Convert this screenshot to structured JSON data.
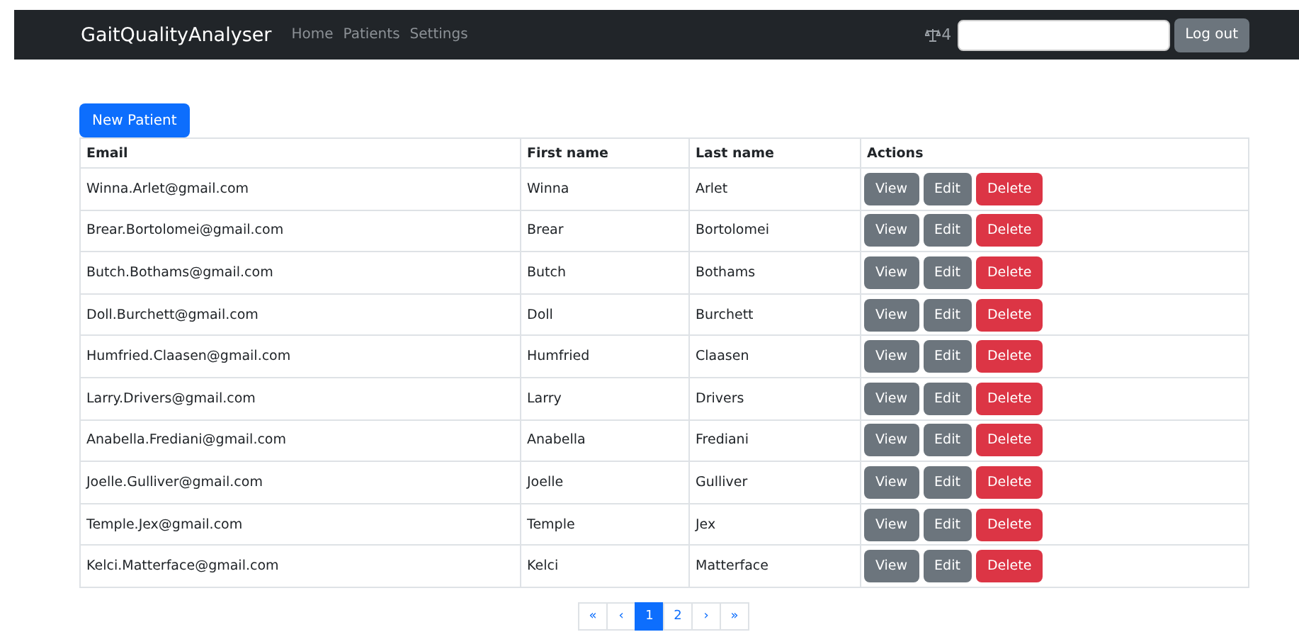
{
  "navbar": {
    "brand": "GaitQualityAnalyser",
    "links": [
      "Home",
      "Patients",
      "Settings"
    ],
    "badge_count": "4",
    "logout": "Log out"
  },
  "new_button": "New Patient",
  "table": {
    "columns": [
      "Email",
      "First name",
      "Last name",
      "Actions"
    ],
    "rows": [
      {
        "email": "Winna.Arlet@gmail.com",
        "first": "Winna",
        "last": "Arlet",
        "actions": [
          {
            "label": "View",
            "kind": "secondary"
          },
          {
            "label": "Edit",
            "kind": "secondary"
          },
          {
            "label": "Delete",
            "kind": "danger"
          }
        ]
      },
      {
        "email": "Brear.Bortolomei@gmail.com",
        "first": "Brear",
        "last": "Bortolomei",
        "actions": [
          {
            "label": "View",
            "kind": "secondary"
          },
          {
            "label": "Edit",
            "kind": "secondary"
          },
          {
            "label": "Delete",
            "kind": "danger"
          }
        ]
      },
      {
        "email": "Butch.Bothams@gmail.com",
        "first": "Butch",
        "last": "Bothams",
        "actions": [
          {
            "label": "View",
            "kind": "secondary"
          },
          {
            "label": "Edit",
            "kind": "secondary"
          },
          {
            "label": "Delete",
            "kind": "danger"
          }
        ]
      },
      {
        "email": "Doll.Burchett@gmail.com",
        "first": "Doll",
        "last": "Burchett",
        "actions": [
          {
            "label": "View",
            "kind": "secondary"
          },
          {
            "label": "Edit",
            "kind": "secondary"
          },
          {
            "label": "Delete",
            "kind": "danger"
          }
        ]
      },
      {
        "email": "Humfried.Claasen@gmail.com",
        "first": "Humfried",
        "last": "Claasen",
        "actions": [
          {
            "label": "View",
            "kind": "secondary"
          },
          {
            "label": "Edit",
            "kind": "secondary"
          },
          {
            "label": "Delete",
            "kind": "danger"
          }
        ]
      },
      {
        "email": "Larry.Drivers@gmail.com",
        "first": "Larry",
        "last": "Drivers",
        "actions": [
          {
            "label": "View",
            "kind": "secondary"
          },
          {
            "label": "Edit",
            "kind": "secondary"
          },
          {
            "label": "Delete",
            "kind": "danger"
          }
        ]
      },
      {
        "email": "Anabella.Frediani@gmail.com",
        "first": "Anabella",
        "last": "Frediani",
        "actions": [
          {
            "label": "View",
            "kind": "secondary"
          },
          {
            "label": "Edit",
            "kind": "secondary"
          },
          {
            "label": "Delete",
            "kind": "danger"
          }
        ]
      },
      {
        "email": "Joelle.Gulliver@gmail.com",
        "first": "Joelle",
        "last": "Gulliver",
        "actions": [
          {
            "label": "View",
            "kind": "secondary"
          },
          {
            "label": "Edit",
            "kind": "secondary"
          },
          {
            "label": "Delete",
            "kind": "danger"
          }
        ]
      },
      {
        "email": "Temple.Jex@gmail.com",
        "first": "Temple",
        "last": "Jex",
        "actions": [
          {
            "label": "View",
            "kind": "secondary"
          },
          {
            "label": "Edit",
            "kind": "secondary"
          },
          {
            "label": "Delete",
            "kind": "danger"
          }
        ]
      },
      {
        "email": "Kelci.Matterface@gmail.com",
        "first": "Kelci",
        "last": "Matterface",
        "actions": [
          {
            "label": "View",
            "kind": "secondary"
          },
          {
            "label": "Edit",
            "kind": "secondary"
          },
          {
            "label": "Delete",
            "kind": "danger"
          }
        ]
      }
    ]
  },
  "pagination": [
    {
      "label": "«",
      "selected": false
    },
    {
      "label": "‹",
      "selected": false
    },
    {
      "label": "1",
      "selected": true
    },
    {
      "label": "2",
      "selected": false
    },
    {
      "label": "›",
      "selected": false
    },
    {
      "label": "»",
      "selected": false
    }
  ]
}
